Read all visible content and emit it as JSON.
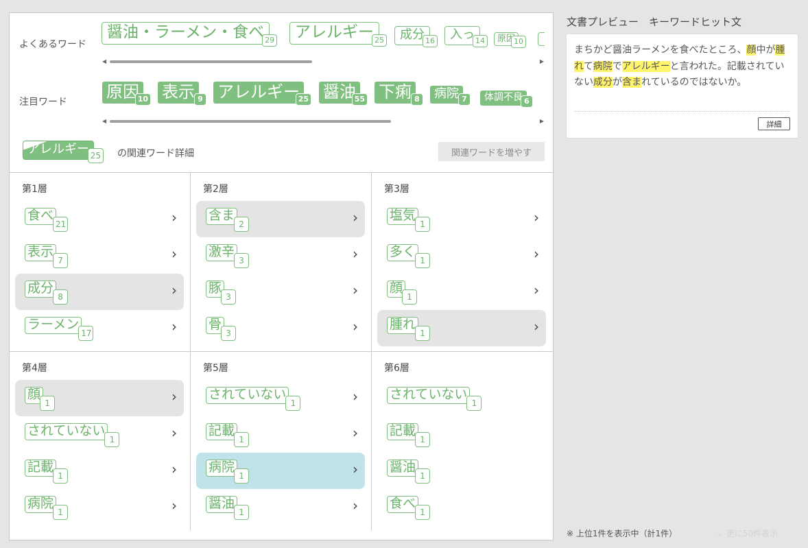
{
  "frequent": {
    "label": "よくあるワード",
    "chips": [
      {
        "text": "醤油・ラーメン・食べ",
        "count": "29"
      },
      {
        "text": "アレルギー",
        "count": "25"
      },
      {
        "text": "成分",
        "count": "16"
      },
      {
        "text": "入っ",
        "count": "14"
      },
      {
        "text": "原因",
        "count": "10"
      }
    ]
  },
  "attention": {
    "label": "注目ワード",
    "chips": [
      {
        "text": "原因",
        "count": "10"
      },
      {
        "text": "表示",
        "count": "9"
      },
      {
        "text": "アレルギー",
        "count": "25"
      },
      {
        "text": "醤油",
        "count": "55"
      },
      {
        "text": "下痢",
        "count": "8"
      },
      {
        "text": "病院",
        "count": "7"
      },
      {
        "text": "体調不良",
        "count": "6"
      }
    ]
  },
  "selected": {
    "text": "アレルギー",
    "count": "25",
    "caption": "の関連ワード詳細"
  },
  "increase_button": "関連ワードを増やす",
  "layers": [
    {
      "title": "第1層",
      "items": [
        {
          "text": "食べ",
          "count": "21"
        },
        {
          "text": "表示",
          "count": "7"
        },
        {
          "text": "成分",
          "count": "8"
        },
        {
          "text": "ラーメン",
          "count": "17"
        }
      ]
    },
    {
      "title": "第2層",
      "items": [
        {
          "text": "含ま",
          "count": "2"
        },
        {
          "text": "激辛",
          "count": "3"
        },
        {
          "text": "豚",
          "count": "3"
        },
        {
          "text": "骨",
          "count": "3"
        }
      ]
    },
    {
      "title": "第3層",
      "items": [
        {
          "text": "塩気",
          "count": "1"
        },
        {
          "text": "多く",
          "count": "1"
        },
        {
          "text": "顔",
          "count": "1"
        },
        {
          "text": "腫れ",
          "count": "1"
        }
      ]
    },
    {
      "title": "第4層",
      "items": [
        {
          "text": "顔",
          "count": "1"
        },
        {
          "text": "されていない",
          "count": "1"
        },
        {
          "text": "記載",
          "count": "1"
        },
        {
          "text": "病院",
          "count": "1"
        }
      ]
    },
    {
      "title": "第5層",
      "items": [
        {
          "text": "されていない",
          "count": "1"
        },
        {
          "text": "記載",
          "count": "1"
        },
        {
          "text": "病院",
          "count": "1"
        },
        {
          "text": "醤油",
          "count": "1"
        }
      ]
    },
    {
      "title": "第6層",
      "items": [
        {
          "text": "されていない",
          "count": "1"
        },
        {
          "text": "記載",
          "count": "1"
        },
        {
          "text": "醤油",
          "count": "1"
        },
        {
          "text": "食べ",
          "count": "1"
        }
      ]
    }
  ],
  "preview": {
    "title": "文書プレビュー　キーワードヒット文",
    "segments": [
      {
        "t": "まちかど醤油ラーメンを食べたところ、",
        "hl": false
      },
      {
        "t": "顔",
        "hl": true
      },
      {
        "t": "中が",
        "hl": false
      },
      {
        "t": "腫れ",
        "hl": true
      },
      {
        "t": "て",
        "hl": false
      },
      {
        "t": "病院",
        "hl": true
      },
      {
        "t": "で",
        "hl": false
      },
      {
        "t": "アレルギー",
        "hl": true
      },
      {
        "t": "と言われた。記載されていない",
        "hl": false
      },
      {
        "t": "成分",
        "hl": true
      },
      {
        "t": "が",
        "hl": false
      },
      {
        "t": "含ま",
        "hl": true
      },
      {
        "t": "れているのではないか。",
        "hl": false
      }
    ],
    "detail_button": "詳細"
  },
  "footer_note": "※ 上位1件を表示中（計1件）",
  "more_link": "更に50件表示",
  "colors": {
    "accent_green": "#7fbf7f",
    "highlight": "#fff46b",
    "selected_blue": "#bfe3e8",
    "selected_gray": "#e4e4e4"
  }
}
